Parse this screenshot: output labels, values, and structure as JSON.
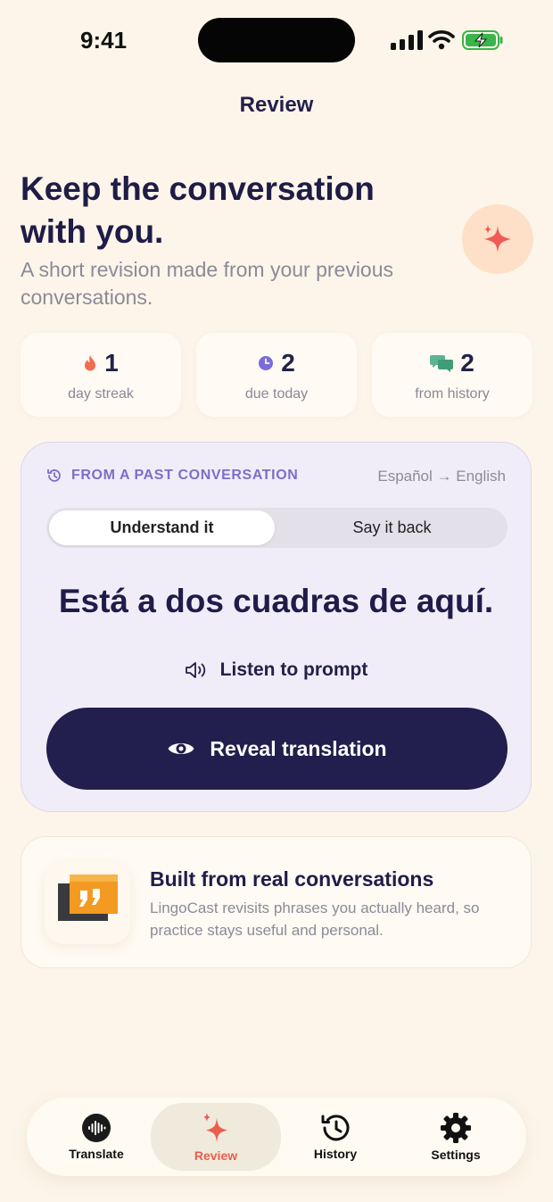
{
  "status_bar": {
    "time": "9:41"
  },
  "nav": {
    "title": "Review"
  },
  "hero": {
    "headline": "Keep the conversation with you.",
    "subtitle": "A short revision made from your previous conversations."
  },
  "stats": [
    {
      "value": "1",
      "label": "day streak",
      "icon": "flame-icon",
      "color": "#f06d4f"
    },
    {
      "value": "2",
      "label": "due today",
      "icon": "clock-icon",
      "color": "#7b6bdc"
    },
    {
      "value": "2",
      "label": "from history",
      "icon": "chat-bubbles-icon",
      "color": "#5cb58f"
    }
  ],
  "card": {
    "source_label": "FROM A PAST CONVERSATION",
    "language_pair": "Español → English",
    "modes": [
      "Understand it",
      "Say it back"
    ],
    "selected_mode": "Understand it",
    "prompt": "Está a dos cuadras de aquí.",
    "listen_label": "Listen to prompt",
    "reveal_label": "Reveal translation"
  },
  "info": {
    "title": "Built from real conversations",
    "body": "LingoCast revisits phrases you actually heard, so practice stays useful and personal."
  },
  "tabbar": {
    "items": [
      {
        "label": "Translate",
        "icon": "waveform-icon"
      },
      {
        "label": "Review",
        "icon": "sparkles-icon"
      },
      {
        "label": "History",
        "icon": "history-icon"
      },
      {
        "label": "Settings",
        "icon": "gear-icon"
      }
    ],
    "active": "Review"
  },
  "colors": {
    "background": "#fdf5ea",
    "primary": "#221e4d",
    "accent": "#ea5d4f",
    "card": "#f1edf8"
  }
}
